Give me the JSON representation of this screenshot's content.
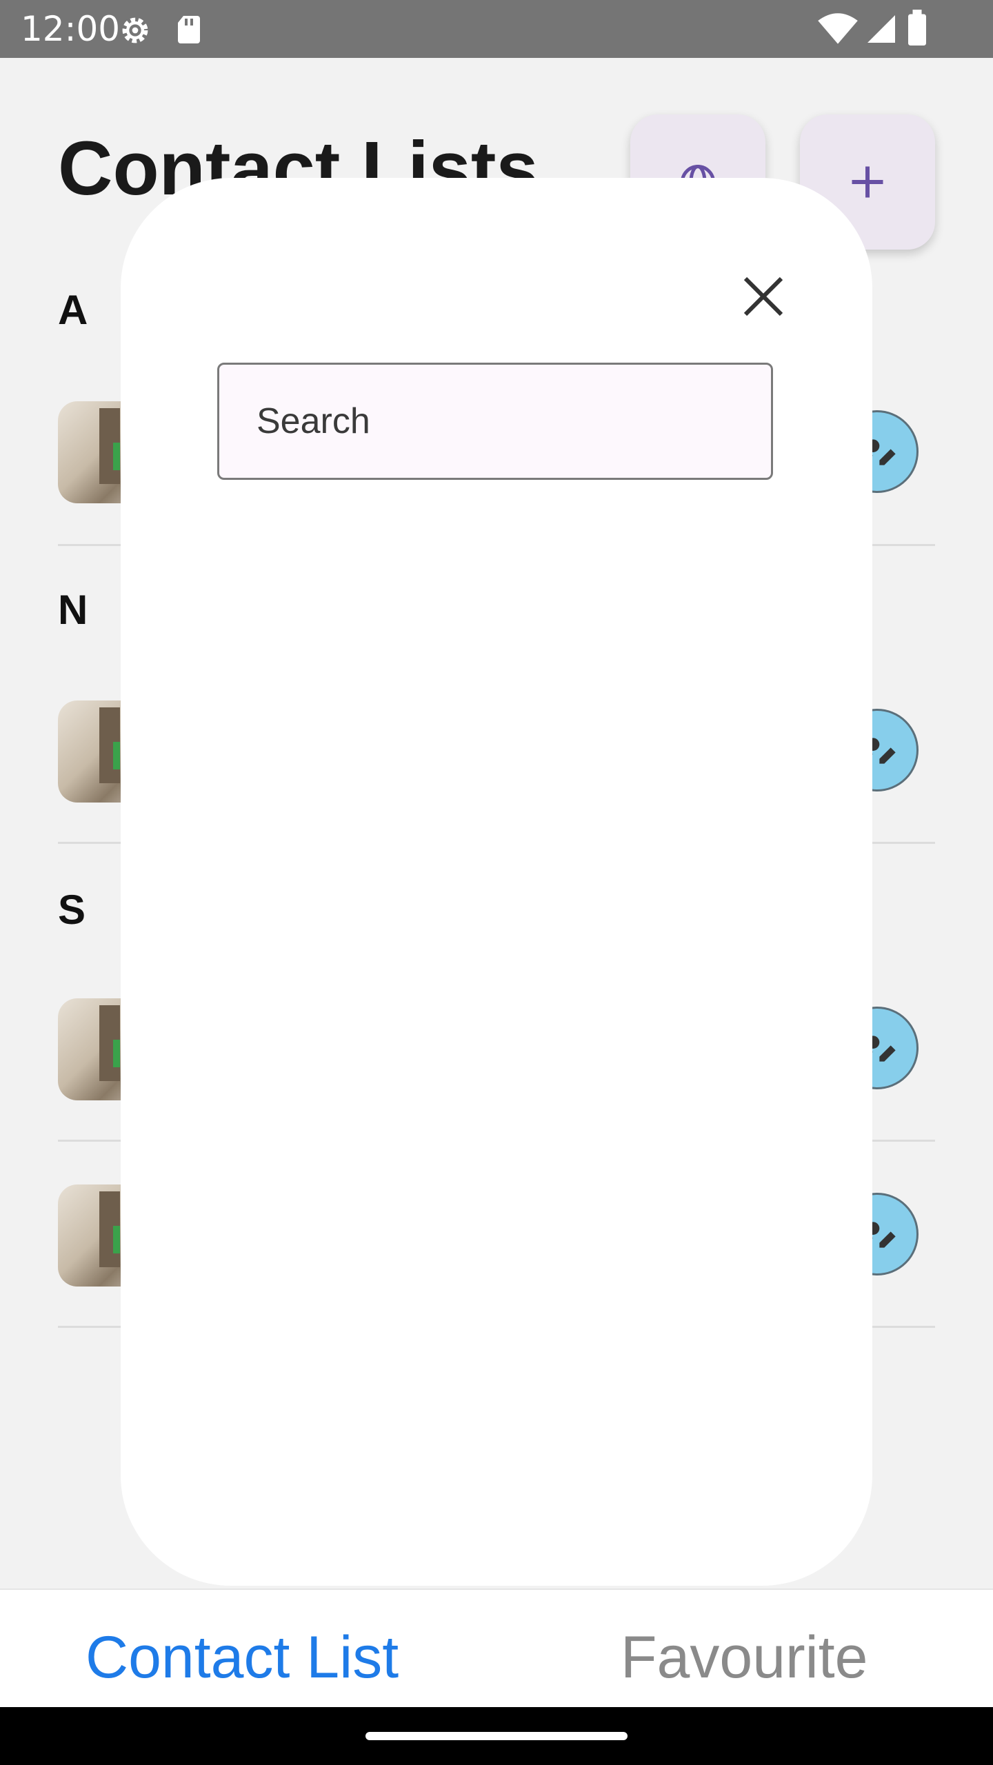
{
  "status_bar": {
    "time": "12:00",
    "icons": [
      "gear-icon",
      "sd-card-icon",
      "wifi-icon",
      "signal-icon",
      "battery-icon"
    ]
  },
  "header": {
    "title": "Contact Lists",
    "actions": [
      {
        "name": "globe-button",
        "icon": "globe-icon"
      },
      {
        "name": "add-button",
        "icon": "plus-icon"
      }
    ]
  },
  "sections": [
    {
      "letter": "A",
      "rows": 1
    },
    {
      "letter": "N",
      "rows": 1
    },
    {
      "letter": "S",
      "rows": 2
    }
  ],
  "modal": {
    "search_placeholder": "Search",
    "close_icon": "close-icon"
  },
  "tabs": {
    "contact_list": "Contact List",
    "favourite": "Favourite"
  },
  "colors": {
    "accent_tab": "#1e7be8",
    "edit_button": "#87ceeb",
    "fab_bg": "#ece6f0",
    "fab_icon": "#6750a4"
  }
}
